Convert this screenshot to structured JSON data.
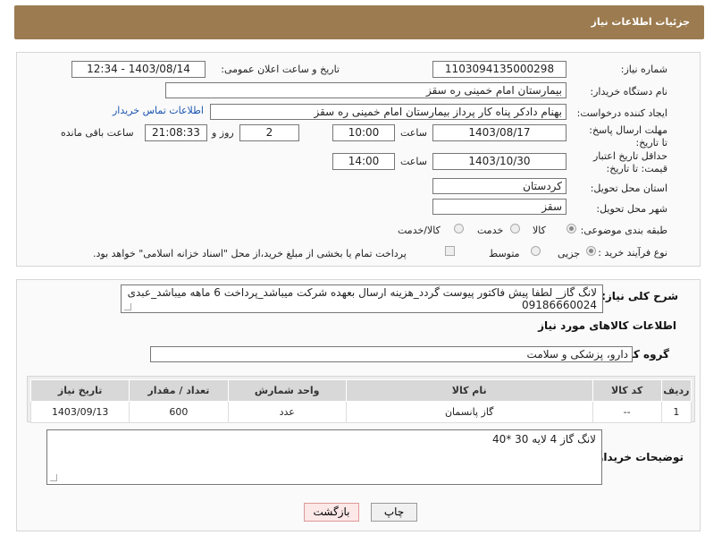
{
  "header": {
    "title": "جزئیات اطلاعات نیاز"
  },
  "form": {
    "need_number_label": "شماره نیاز:",
    "need_number": "1103094135000298",
    "announce_label": "تاریخ و ساعت اعلان عمومی:",
    "announce_value": "1403/08/14 - 12:34",
    "buyer_org_label": "نام دستگاه خریدار:",
    "buyer_org": "بیمارستان امام خمینی  ره  سقز",
    "requester_label": "ایجاد کننده درخواست:",
    "requester": "بهنام دادکر پناه کار پرداز بیمارستان امام خمینی  ره  سقز",
    "contact_link": "اطلاعات تماس خریدار",
    "deadline_label": "مهلت ارسال پاسخ: تا تاریخ:",
    "deadline_date": "1403/08/17",
    "time_label": "ساعت",
    "deadline_time": "10:00",
    "days_value": "2",
    "days_label": "روز و",
    "remaining_time": "21:08:33",
    "remaining_label": "ساعت باقی مانده",
    "validity_label": "حداقل تاریخ اعتبار قیمت: تا تاریخ:",
    "validity_date": "1403/10/30",
    "validity_time_label": "ساعت",
    "validity_time": "14:00",
    "province_label": "استان محل تحویل:",
    "province": "کردستان",
    "city_label": "شهر محل تحویل:",
    "city": "سقز",
    "category_label": "طبقه بندی موضوعی:",
    "category_options": [
      "کالا",
      "خدمت",
      "کالا/خدمت"
    ],
    "process_label": "نوع فرآیند خرید :",
    "process_options": [
      "جزیی",
      "متوسط"
    ],
    "payment_note": "پرداخت تمام یا بخشی از مبلغ خرید،از محل \"اسناد خزانه اسلامی\" خواهد بود."
  },
  "description": {
    "label": "شرح کلی نیاز:",
    "text": "لانگ گاز_ لطفا پیش فاکتور پیوست گردد_هزینه ارسال بعهده شرکت میباشد_پرداخت 6 ماهه میباشد_عبدی 09186660024"
  },
  "goods": {
    "section_title": "اطلاعات کالاهای مورد نیاز",
    "group_label": "گروه کالا:",
    "group_value": "دارو، پزشکی و سلامت",
    "columns": [
      "ردیف",
      "کد کالا",
      "نام کالا",
      "واحد شمارش",
      "تعداد / مقدار",
      "تاریخ نیاز"
    ],
    "rows": [
      [
        "1",
        "--",
        "گاز پانسمان",
        "عدد",
        "600",
        "1403/09/13"
      ]
    ]
  },
  "notes": {
    "label": "توضیحات خریدار:",
    "text": "لانگ گاز 4 لایه  30 *40"
  },
  "buttons": {
    "print": "چاپ",
    "back": "بازگشت"
  }
}
